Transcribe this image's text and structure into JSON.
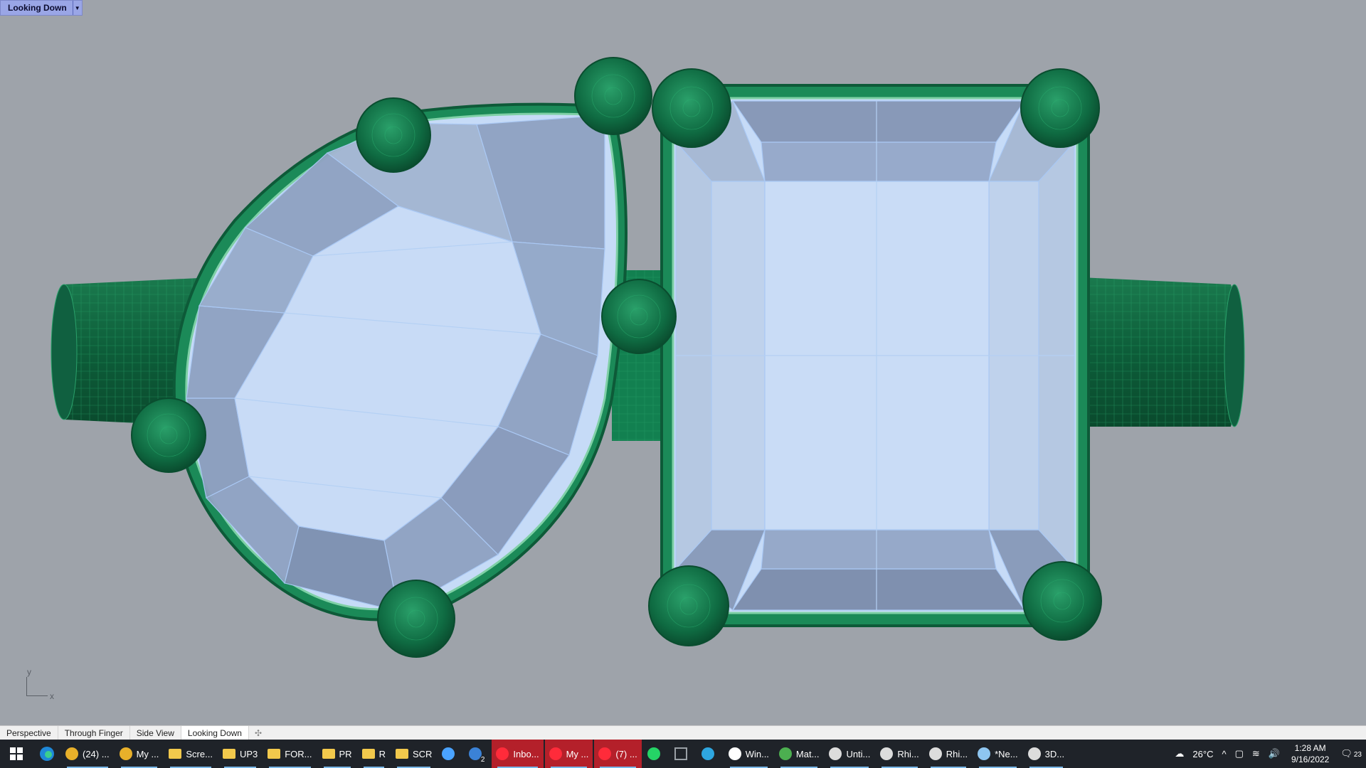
{
  "viewport": {
    "label": "Looking Down",
    "axis_y": "y",
    "axis_x": "x"
  },
  "colors": {
    "background": "#9ea3aa",
    "metal": "#1f8a5a",
    "metal_dark": "#0f5a38",
    "gem": "#c9dcf6",
    "gem_facet": "#8fa4c4",
    "gem_edge": "#a9c8f4"
  },
  "viewport_tabs": [
    {
      "label": "Perspective",
      "active": false
    },
    {
      "label": "Through Finger",
      "active": false
    },
    {
      "label": "Side View",
      "active": false
    },
    {
      "label": "Looking Down",
      "active": true
    }
  ],
  "taskbar": {
    "start_icon": "windows-logo",
    "pinned": [
      {
        "label": "",
        "icon": "edge-icon"
      }
    ],
    "items": [
      {
        "label": "(24) ...",
        "icon": "chrome-icon",
        "style": "normal"
      },
      {
        "label": "My ...",
        "icon": "chrome-icon",
        "style": "normal"
      },
      {
        "label": "Scre...",
        "icon": "folder-icon",
        "style": "normal"
      },
      {
        "label": "UP3",
        "icon": "folder-icon",
        "style": "normal"
      },
      {
        "label": "FOR...",
        "icon": "folder-icon",
        "style": "normal"
      },
      {
        "label": "PR",
        "icon": "folder-icon",
        "style": "normal"
      },
      {
        "label": "R",
        "icon": "folder-icon",
        "style": "normal"
      },
      {
        "label": "SCR",
        "icon": "folder-icon",
        "style": "normal"
      },
      {
        "label": "",
        "icon": "store-icon",
        "style": "normal"
      },
      {
        "label": "",
        "icon": "mail-icon",
        "style": "normal",
        "badge": "2"
      },
      {
        "label": "Inbo...",
        "icon": "opera-icon",
        "style": "red"
      },
      {
        "label": "My ...",
        "icon": "opera-icon",
        "style": "red"
      },
      {
        "label": "(7) ...",
        "icon": "opera-icon",
        "style": "red"
      },
      {
        "label": "",
        "icon": "whatsapp-icon",
        "style": "normal"
      },
      {
        "label": "",
        "icon": "calculator-icon",
        "style": "normal"
      },
      {
        "label": "",
        "icon": "telegram-icon",
        "style": "normal"
      },
      {
        "label": "Win...",
        "icon": "shield-icon",
        "style": "normal"
      },
      {
        "label": "Mat...",
        "icon": "matrix-icon",
        "style": "normal"
      },
      {
        "label": "Unti...",
        "icon": "rhino-icon",
        "style": "normal"
      },
      {
        "label": "Rhi...",
        "icon": "rhino-icon",
        "style": "normal"
      },
      {
        "label": "Rhi...",
        "icon": "rhino-icon",
        "style": "normal"
      },
      {
        "label": "*Ne...",
        "icon": "notepad-icon",
        "style": "normal"
      },
      {
        "label": "3D...",
        "icon": "rhino-icon",
        "style": "normal"
      }
    ],
    "tray": {
      "weather": "26°C",
      "time": "1:28 AM",
      "date": "9/16/2022",
      "notifications": "23"
    }
  }
}
